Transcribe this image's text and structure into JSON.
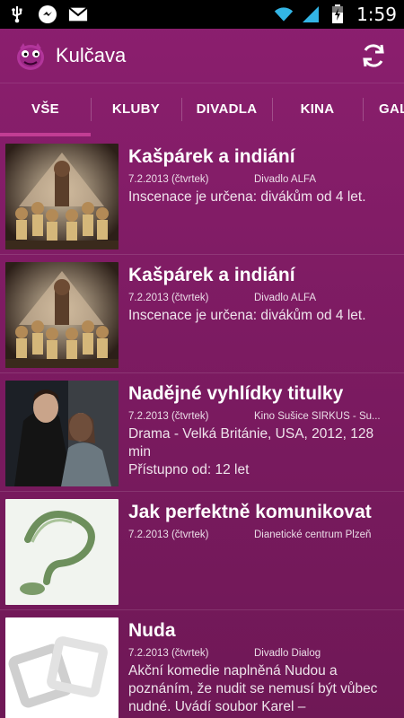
{
  "status_bar": {
    "time": "1:59",
    "icons": [
      "usb-icon",
      "messenger-icon",
      "gmail-icon",
      "wifi-icon",
      "signal-icon",
      "battery-icon"
    ]
  },
  "action_bar": {
    "title": "Kulčava",
    "logo_icon": "purple-creature-logo",
    "refresh_icon": "refresh-icon"
  },
  "tabs": [
    {
      "label": "VŠE",
      "selected": true
    },
    {
      "label": "KLUBY",
      "selected": false
    },
    {
      "label": "DIVADLA",
      "selected": false
    },
    {
      "label": "KINA",
      "selected": false
    },
    {
      "label": "GAL",
      "selected": false
    }
  ],
  "events": [
    {
      "title": "Kašpárek a indiání",
      "date": "7.2.2013 (čtvrtek)",
      "venue": "Divadlo ALFA",
      "description": "Inscenace je určena: divákům od 4 let.",
      "thumb": "puppet-stage"
    },
    {
      "title": "Kašpárek a indiání",
      "date": "7.2.2013 (čtvrtek)",
      "venue": "Divadlo ALFA",
      "description": "Inscenace je určena: divákům od 4 let.",
      "thumb": "puppet-stage"
    },
    {
      "title": "Nadějné vyhlídky titulky",
      "date": "7.2.2013 (čtvrtek)",
      "venue": "Kino Sušice SIRKUS - Su...",
      "description": "Drama - Velká Británie, USA, 2012, 128 min\nPřístupno od: 12 let",
      "thumb": "film-couple"
    },
    {
      "title": "Jak perfektně komunikovat",
      "date": "7.2.2013 (čtvrtek)",
      "venue": "Dianetické centrum Plzeň",
      "description": "",
      "thumb": "question-mark"
    },
    {
      "title": "Nuda",
      "date": "7.2.2013 (čtvrtek)",
      "venue": "Divadlo Dialog",
      "description": "Akční komedie naplněná Nudou a poznáním, že nudit se nemusí být vůbec nudné. Uvádí soubor Karel –",
      "thumb": "frames-gray"
    }
  ]
}
